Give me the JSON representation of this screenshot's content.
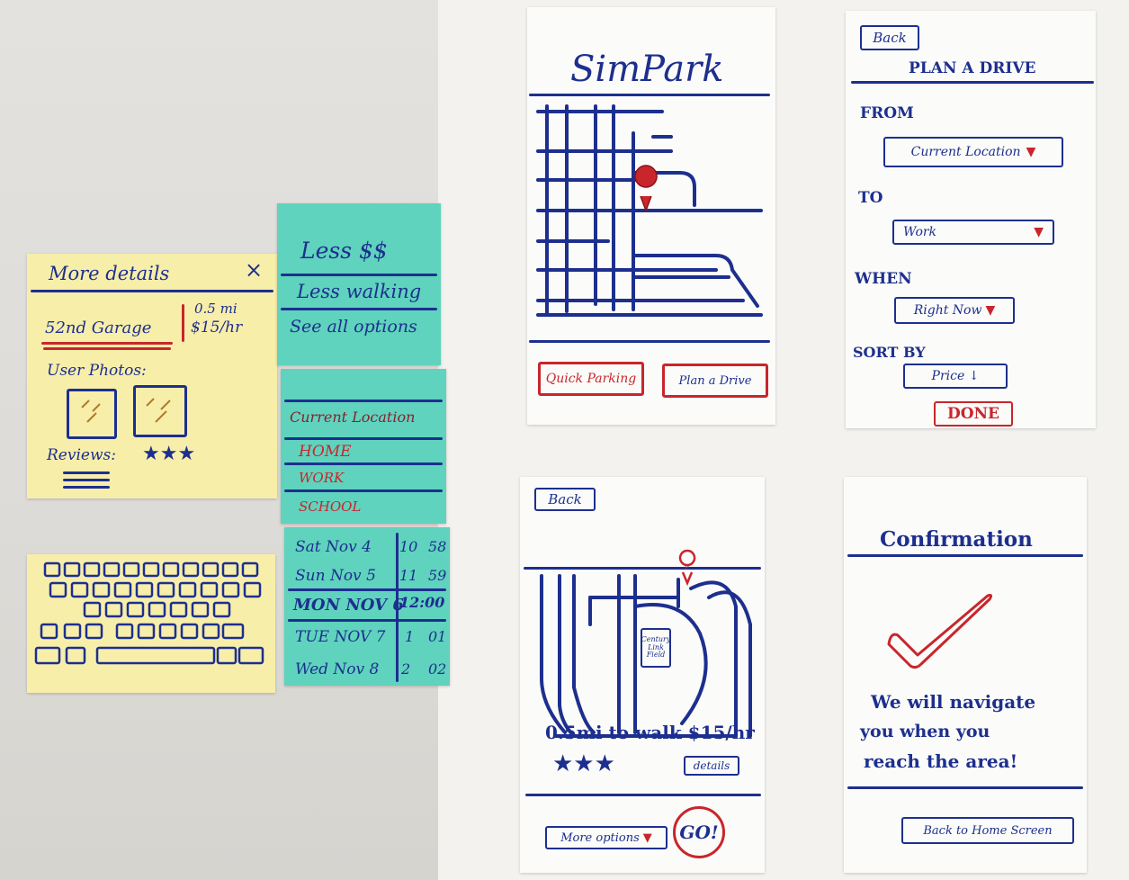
{
  "details_card": {
    "title": "More details",
    "close": "×",
    "garage": "52nd Garage",
    "distance": "0.5 mi",
    "rate": "$15/hr",
    "photos_label": "User Photos:",
    "reviews_label": "Reviews:",
    "reviews_stars": "★★★"
  },
  "filter_options": [
    "Less $$",
    "Less walking",
    "See all options"
  ],
  "locations": {
    "header": "Current Location",
    "items": [
      "HOME",
      "WORK",
      "SCHOOL"
    ]
  },
  "date_picker": [
    {
      "day": "Sat Nov 4",
      "hour": "10",
      "min": "58"
    },
    {
      "day": "Sun Nov 5",
      "hour": "11",
      "min": "59"
    },
    {
      "day": "MON NOV 6",
      "time": "12:00"
    },
    {
      "day": "TUE NOV 7",
      "hour": "1",
      "min": "01"
    },
    {
      "day": "Wed Nov 8",
      "hour": "2",
      "min": "02"
    }
  ],
  "home_screen": {
    "title": "SimPark",
    "quick_parking": "Quick Parking",
    "plan_drive": "Plan a Drive"
  },
  "plan_screen": {
    "back": "Back",
    "title": "PLAN A DRIVE",
    "from_label": "FROM",
    "from_value": "Current Location",
    "to_label": "TO",
    "to_value": "Work",
    "when_label": "WHEN",
    "when_value": "Right Now",
    "sort_label": "SORT BY",
    "sort_value": "Price ↓",
    "done": "DONE"
  },
  "result_screen": {
    "back": "Back",
    "map_label": "Century Link Field",
    "map_pin": "P",
    "summary": "0.5mi to walk $15/hr",
    "stars": "★★★",
    "details": "details",
    "more_options": "More options",
    "go": "GO!"
  },
  "confirm_screen": {
    "title": "Confirmation",
    "message_1": "We will navigate",
    "message_2": "you when you",
    "message_3": "reach the area!",
    "back_home": "Back to Home Screen"
  }
}
